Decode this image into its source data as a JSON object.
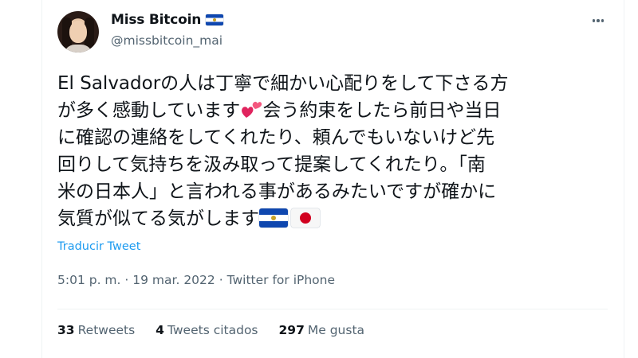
{
  "author": {
    "display_name": "Miss Bitcoin",
    "handle": "@missbitcoin_mai",
    "flag_icon": "el-salvador-flag-icon"
  },
  "tweet": {
    "text_segments": [
      "El Salvadorの人は丁寧で細かい心配りをして下さる方\nが多く感動しています",
      "会う約束をしたら前日や当日\nに確認の連絡をしてくれたり、頼んでもいないけど先\n回りして気持ちを汲み取って提案してくれたり。「南\n米の日本人」と言われる事があるみたいですが確かに\n気質が似てる気がします"
    ],
    "emojis": [
      "two-hearts-emoji",
      "el-salvador-flag-emoji",
      "japan-flag-emoji"
    ],
    "translate_label": "Traducir Tweet"
  },
  "meta": {
    "time": "5:01 p. m.",
    "separator": "·",
    "date": "19 mar. 2022",
    "source": "Twitter for iPhone"
  },
  "stats": {
    "retweets_count": "33",
    "retweets_label": "Retweets",
    "quotes_count": "4",
    "quotes_label": "Tweets citados",
    "likes_count": "297",
    "likes_label": "Me gusta"
  },
  "colors": {
    "accent": "#1d9bf0",
    "text": "#0f1419",
    "muted": "#536471",
    "border": "#eff3f4"
  }
}
